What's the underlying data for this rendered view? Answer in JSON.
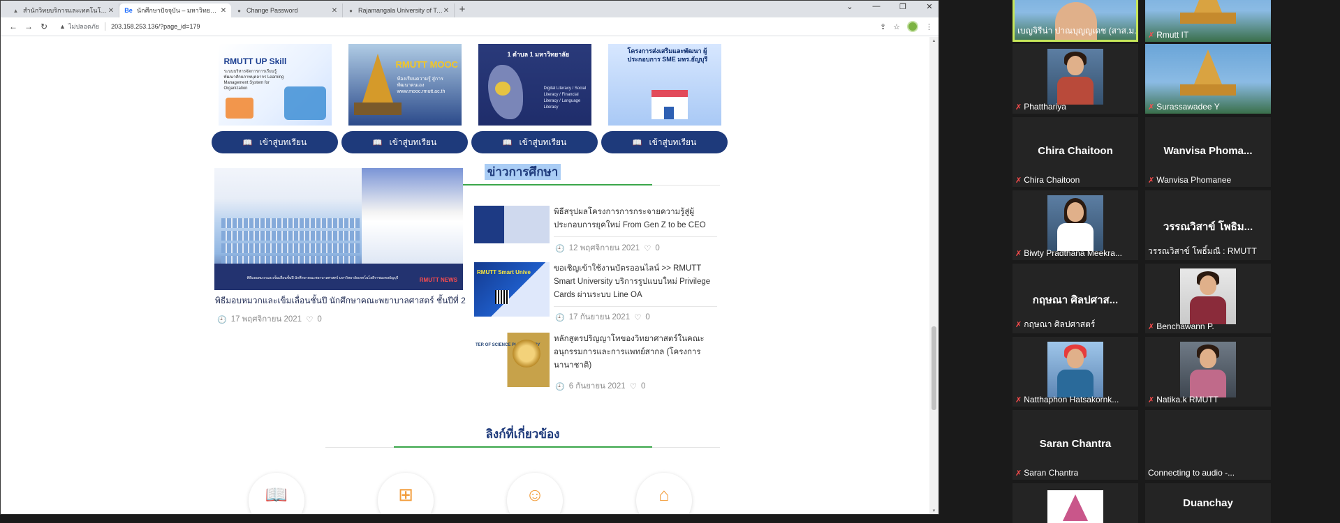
{
  "browser": {
    "tabs": [
      {
        "title": "สำนักวิทยบริการและเทคโนโลยีสารสนเทศ",
        "favicon": "page-icon"
      },
      {
        "title": "นักศึกษาปัจจุบัน – มหาวิทยาลัยเทคโนโลยี",
        "favicon": "Be"
      },
      {
        "title": "Change Password",
        "favicon": "page-icon"
      },
      {
        "title": "Rajamangala University of Techn",
        "favicon": "page-icon"
      }
    ],
    "new_tab": "+",
    "security_label": "ไม่ปลอดภัย",
    "url": "203.158.253.136/?page_id=179",
    "window_controls": {
      "tablist": "⌄",
      "minimize": "—",
      "restore": "❐",
      "close": "✕"
    }
  },
  "page": {
    "courses": [
      {
        "banner_title": "RMUTT UP Skill",
        "banner_sub": "ระบบบริหารจัดการการเรียนรู้ พัฒนาศักยภาพบุคลากร Learning Management System for Organization",
        "button": "เข้าสู่บทเรียน"
      },
      {
        "banner_title": "RMUTT MOOC",
        "banner_sub": "ห้องเรียนความรู้ สู่การพัฒนาตนเอง www.mooc.rmutt.ac.th",
        "button": "เข้าสู่บทเรียน"
      },
      {
        "banner_title": "1 ตำบล 1 มหาวิทยาลัย",
        "banner_sub": "Digital Literacy / Social Literacy / Financial Literacy / Language Literacy",
        "button": "เข้าสู่บทเรียน"
      },
      {
        "banner_title": "โครงการส่งเสริมและพัฒนา ผู้ประกอบการ SME มทร.ธัญบุรี",
        "banner_sub": "",
        "button": "เข้าสู่บทเรียน"
      }
    ],
    "news_section_title": "ข่าวการศึกษา",
    "featured": {
      "image_caption": "พิธีมอบหมวกและเข็มเลื่อนชั้นปี นักศึกษาคณะพยาบาลศาสตร์ มหาวิทยาลัยเทคโนโลยีราชมงคลธัญบุรี",
      "brand": "RMUTT NEWS",
      "title": "พิธีมอบหมวกและเข็มเลื่อนชั้นปี นักศึกษาคณะพยาบาลศาสตร์ ชั้นปีที่ 2",
      "date": "17 พฤศจิกายน 2021",
      "likes": "0"
    },
    "news": [
      {
        "title": "พิธีสรุปผลโครงการการกระจายความรู้สู่ผู้ประกอบการยุคใหม่ From Gen Z to be CEO",
        "date": "12 พฤศจิกายน 2021",
        "likes": "0",
        "thumb_label": ""
      },
      {
        "title": "ขอเชิญเข้าใช้งานบัตรออนไลน์ >> RMUTT Smart University บริการรูปแบบใหม่ Privilege Cards ผ่านระบบ Line OA",
        "date": "17 กันยายน 2021",
        "likes": "0",
        "thumb_label": "RMUTT Smart Unive"
      },
      {
        "title": "หลักสูตรปริญญาโทของวิทยาศาสตร์ในคณะอนุกรรมการและการแพทย์สากล (โครงการนานาชาติ)",
        "date": "6 กันยายน 2021",
        "likes": "0",
        "thumb_label": "TER OF SCIENCE PLEMENTARY"
      }
    ],
    "links_section_title": "ลิงก์ที่เกี่ยวข้อง",
    "link_icons": [
      "book-icon",
      "windows-icon",
      "user-icon",
      "home-icon"
    ]
  },
  "zoom": {
    "participants": [
      {
        "name": "เบญจิรีน่า ปาณบุญญเดช (สาส.ม...",
        "video": "woman-video",
        "speaking": true,
        "muted": false
      },
      {
        "name": "Rmutt IT",
        "video": "temple",
        "speaking": false,
        "muted": true
      },
      {
        "name": "Phatthariya",
        "video": "person",
        "speaking": false,
        "muted": true
      },
      {
        "name": "Surassawadee Y",
        "video": "temple",
        "speaking": false,
        "muted": true
      },
      {
        "name": "Chira Chaitoon",
        "display": "Chira Chaitoon",
        "speaking": false,
        "muted": true
      },
      {
        "name": "Wanvisa Phomanee",
        "display": "Wanvisa  Phoma...",
        "speaking": false,
        "muted": true
      },
      {
        "name": "Biwty Pradthana Meekra...",
        "video": "person",
        "speaking": false,
        "muted": true
      },
      {
        "name": "วรรณวิสาข์ โพธิ์มณี : RMUTT",
        "display": "วรรณวิสาข์  โพธิม...",
        "speaking": false,
        "muted": false
      },
      {
        "name": "กฤษณา ศิลปศาสตร์",
        "display": "กฤษณา  ศิลปศาส...",
        "speaking": false,
        "muted": true
      },
      {
        "name": "Benchawann P.",
        "video": "person",
        "speaking": false,
        "muted": true
      },
      {
        "name": "Natthaphon Hatsakornk...",
        "video": "person",
        "speaking": false,
        "muted": true
      },
      {
        "name": "Natika.k RMUTT",
        "video": "person",
        "speaking": false,
        "muted": true
      },
      {
        "name": "Saran Chantra",
        "display": "Saran Chantra",
        "speaking": false,
        "muted": true
      },
      {
        "name": "Connecting to audio -...",
        "speaking": false,
        "muted": false
      },
      {
        "name": "",
        "video": "temple-pink",
        "speaking": false,
        "muted": false
      },
      {
        "name": "",
        "display": "Duanchay",
        "speaking": false,
        "muted": false
      }
    ]
  }
}
